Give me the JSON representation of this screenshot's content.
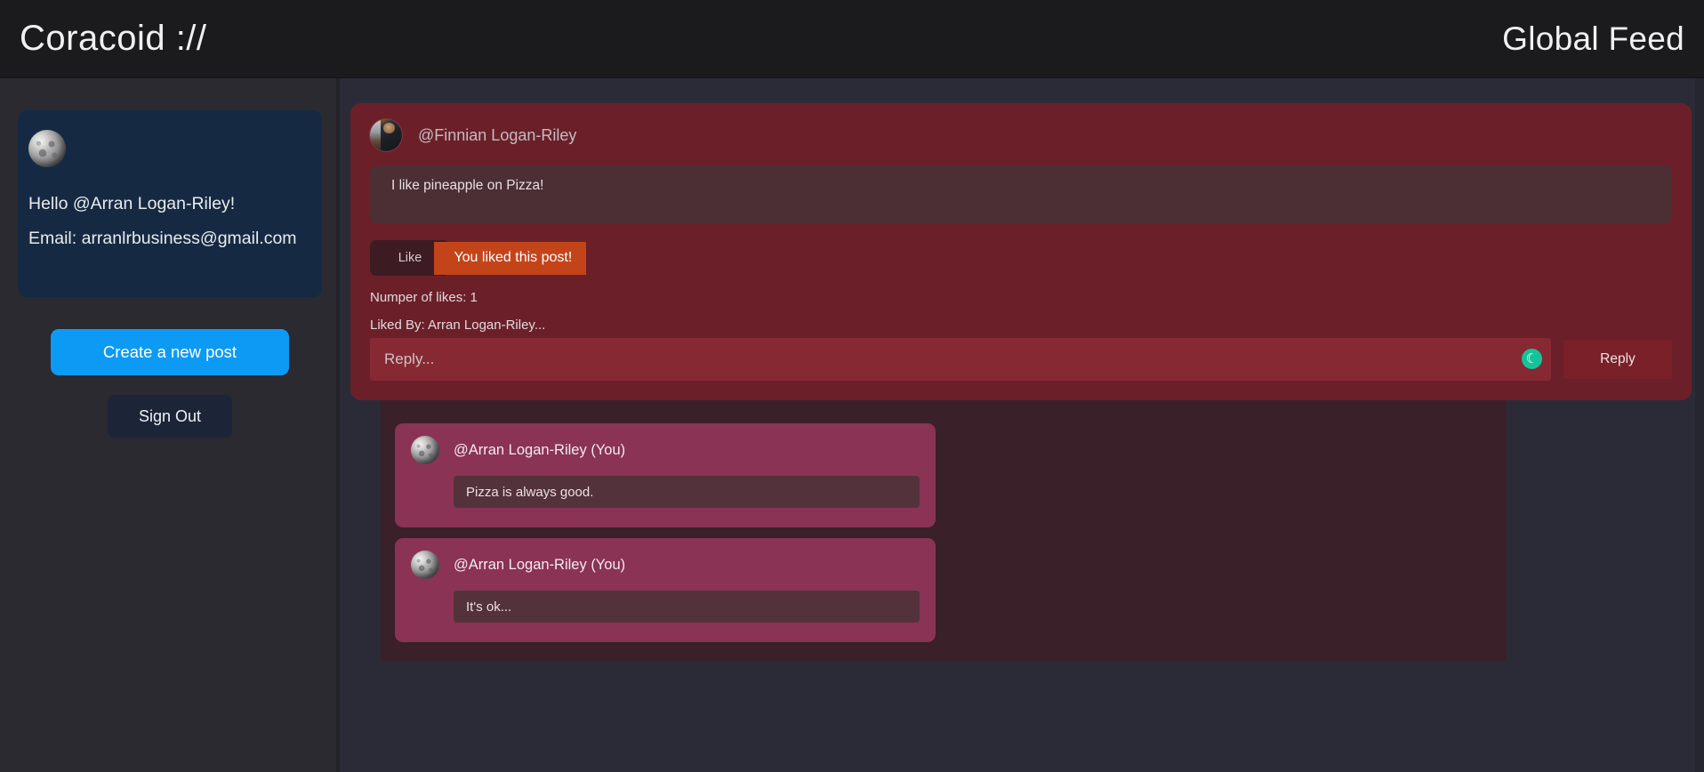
{
  "header": {
    "brand": "Coracoid ://",
    "feed_title": "Global Feed"
  },
  "sidebar": {
    "avatar_icon": "moon-avatar-icon",
    "greeting": "Hello @Arran Logan-Riley!",
    "email_line": "Email: arranlrbusiness@gmail.com",
    "create_post_label": "Create a new post",
    "sign_out_label": "Sign Out"
  },
  "post": {
    "avatar_icon": "user-photo-avatar-icon",
    "author": "@Finnian Logan-Riley",
    "text": "I like pineapple on Pizza!",
    "like_label": "Like",
    "liked_banner": "You liked this post!",
    "likes_count_line": "Numper of likes: 1",
    "liked_by_line": "Liked By: Arran Logan-Riley...",
    "reply_placeholder": "Reply...",
    "reply_value": "",
    "reply_button_label": "Reply",
    "grammar_icon": "crescent-moon-icon",
    "grammar_glyph": "☾"
  },
  "comments": [
    {
      "avatar_icon": "moon-avatar-icon",
      "author": "@Arran Logan-Riley (You)",
      "text": "Pizza is always good."
    },
    {
      "avatar_icon": "moon-avatar-icon",
      "author": "@Arran Logan-Riley (You)",
      "text": "It's ok..."
    }
  ],
  "colors": {
    "accent_blue": "#0d9af5",
    "liked_orange": "#c4441a",
    "post_red": "#6b2029",
    "comment_pink": "#8a3354",
    "grammar_green": "#15c39a"
  }
}
